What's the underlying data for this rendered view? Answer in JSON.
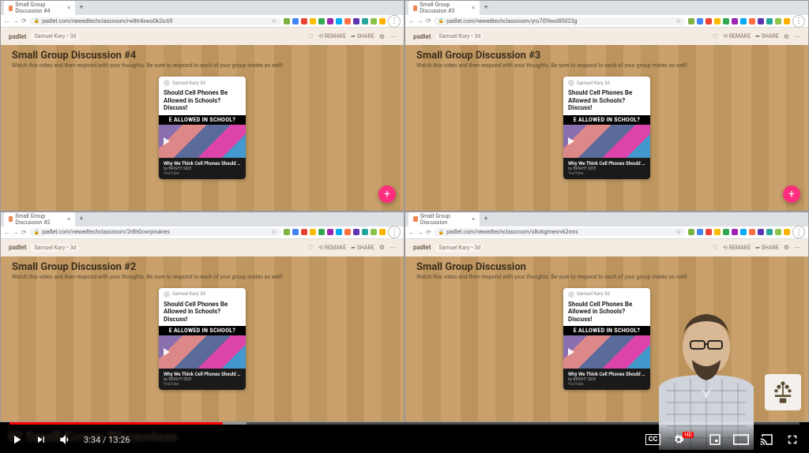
{
  "panes": [
    {
      "tab_label": "Small Group Discussion #4",
      "url": "padlet.com/newedtechclassroom/rw8tr4xwo0k2ic69",
      "author": "Samuel Kary",
      "age": "3d",
      "title": "Small Group Discussion #4",
      "subtitle": "Watch this video and then respond with your thoughts. Be sure to respond to each of your group mates as well!"
    },
    {
      "tab_label": "Small Group Discussion #3",
      "url": "padlet.com/newedtechclassroom/yru7l59wol85023g",
      "author": "Samuel Kary",
      "age": "3d",
      "title": "Small Group Discussion #3",
      "subtitle": "Watch this video and then respond with your thoughts. Be sure to respond to each of your group mates as well!"
    },
    {
      "tab_label": "Small Group Discussion #2",
      "url": "padlet.com/newedtechclassroom/2r8h0cwrpnukres",
      "author": "Samuel Kary",
      "age": "3d",
      "title": "Small Group Discussion #2",
      "subtitle": "Watch this video and then respond with your thoughts. Be sure to respond to each of your group mates as well!"
    },
    {
      "tab_label": "Small Group Discussion",
      "url": "padlet.com/newedtechclassroom/slkzkgmenrvk2mrs",
      "author": "Samuel Kary",
      "age": "3d",
      "title": "Small Group Discussion",
      "subtitle": "Watch this video and then respond with your thoughts. Be sure to respond to each of your group mates as well!"
    }
  ],
  "card": {
    "author": "Samuel Kary",
    "age": "3d",
    "title": "Should Cell Phones Be Allowed in Schools? Discuss!",
    "banner": "E ALLOWED IN SCHOOL?",
    "video_title": "Why We Think Cell Phones Should Be...",
    "video_by": "by BRIGHT SIDE",
    "video_src": "YouTube"
  },
  "header": {
    "remake": "REMAKE",
    "share": "SHARE"
  },
  "logo": "padlet",
  "fab": "+",
  "youtube": {
    "time_current": "3:34",
    "time_total": "13:26",
    "cc": "CC",
    "hd": "HD"
  },
  "caption": "#2 Small Group Discussions",
  "ext_colors": [
    "#7cb342",
    "#4285f4",
    "#ea4335",
    "#fbbc04",
    "#34a853",
    "#9c27b0",
    "#03a9f4",
    "#ff7043",
    "#5e35b1",
    "#26a69a",
    "#8bc34a",
    "#ffb300"
  ]
}
